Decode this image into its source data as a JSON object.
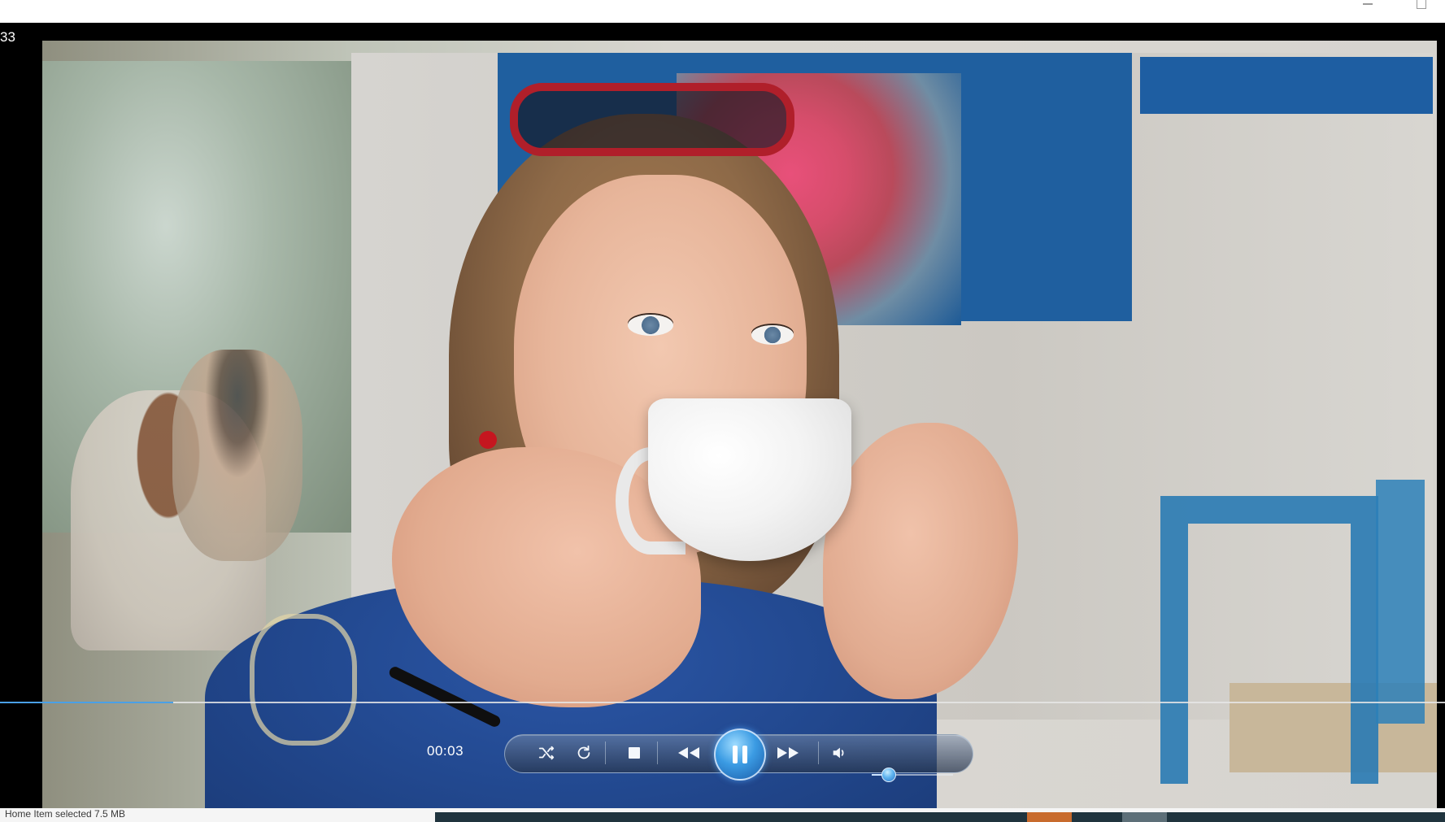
{
  "window": {
    "corner_time": "33"
  },
  "player": {
    "time_elapsed": "00:03",
    "progress": 0.12,
    "volume": 0.2
  },
  "controls": {
    "items": [
      {
        "name": "shuffle-icon",
        "label": ""
      },
      {
        "name": "repeat-icon",
        "label": ""
      },
      {
        "name": "stop-icon",
        "label": ""
      },
      {
        "name": "rewind-icon",
        "label": ""
      },
      {
        "name": "pause-icon",
        "label": ""
      },
      {
        "name": "fast-forward-icon",
        "label": ""
      },
      {
        "name": "volume-icon",
        "label": ""
      }
    ]
  },
  "statusbar": {
    "text": "Home      Item selected      7.5 MB"
  },
  "colors": {
    "accent": "#3b9be3",
    "seek_played": "#4aa0e6"
  }
}
